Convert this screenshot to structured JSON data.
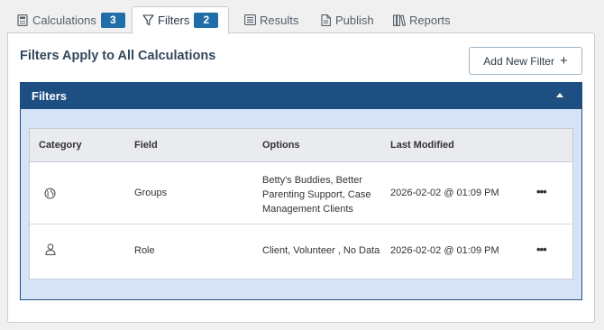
{
  "tabs": [
    {
      "label": "Calculations",
      "badge": "3",
      "icon": "calculator-icon"
    },
    {
      "label": "Filters",
      "badge": "2",
      "icon": "filter-icon"
    },
    {
      "label": "Results",
      "icon": "list-icon"
    },
    {
      "label": "Publish",
      "icon": "document-icon"
    },
    {
      "label": "Reports",
      "icon": "books-icon"
    }
  ],
  "page": {
    "title": "Filters Apply to All Calculations",
    "add_button": "Add New Filter",
    "add_button_icon": "plus-icon"
  },
  "filters_panel": {
    "title": "Filters",
    "header_color": "#1d4f82"
  },
  "table": {
    "columns": [
      "Category",
      "Field",
      "Options",
      "Last Modified"
    ],
    "rows": [
      {
        "category_icon": "globe-icon",
        "field": "Groups",
        "options": "Betty's Buddies, Better Parenting Support, Case Management Clients",
        "last_modified": "2026-02-02 @ 01:09 PM",
        "menu": "•••"
      },
      {
        "category_icon": "user-icon",
        "field": "Role",
        "options": "Client, Volunteer , No Data",
        "last_modified": "2026-02-02 @ 01:09 PM",
        "menu": "•••"
      }
    ]
  },
  "colors": {
    "accent": "#1f6ea8",
    "panel_bg": "#d6e2f6"
  }
}
